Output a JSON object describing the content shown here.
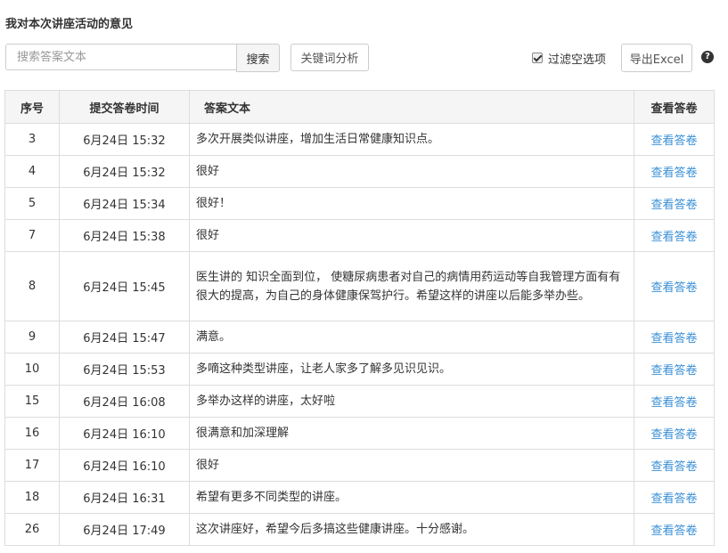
{
  "page": {
    "title": "我对本次讲座活动的意见"
  },
  "toolbar": {
    "search_placeholder": "搜索答案文本",
    "search_value": "",
    "search_label": "搜索",
    "keyword_label": "关键词分析",
    "filter_label": "过滤空选项",
    "filter_checked": true,
    "export_label": "导出Excel",
    "help_icon": "question-circle-icon",
    "help_glyph": "?"
  },
  "table": {
    "headers": [
      "序号",
      "提交答卷时间",
      "答案文本",
      "查看答卷"
    ],
    "rows": [
      {
        "no": "3",
        "time": "6月24日 15:32",
        "text": "多次开展类似讲座，增加生活日常健康知识点。",
        "view": "查看答卷"
      },
      {
        "no": "4",
        "time": "6月24日 15:32",
        "text": "很好",
        "view": "查看答卷"
      },
      {
        "no": "5",
        "time": "6月24日 15:34",
        "text": "很好！",
        "view": "查看答卷"
      },
      {
        "no": "7",
        "time": "6月24日 15:38",
        "text": "很好",
        "view": "查看答卷"
      },
      {
        "no": "8",
        "time": "6月24日 15:45",
        "text": "医生讲的 知识全面到位， 使糖尿病患者对自己的病情用药运动等自我管理方面有有很大的提高，为自己的身体健康保驾护行。希望这样的讲座以后能多举办些。",
        "view": "查看答卷"
      },
      {
        "no": "9",
        "time": "6月24日 15:47",
        "text": "满意。",
        "view": "查看答卷"
      },
      {
        "no": "10",
        "time": "6月24日 15:53",
        "text": "多嘀这种类型讲座，让老人家多了解多见识见识。",
        "view": "查看答卷"
      },
      {
        "no": "15",
        "time": "6月24日 16:08",
        "text": "多举办这样的讲座，太好啦",
        "view": "查看答卷"
      },
      {
        "no": "16",
        "time": "6月24日 16:10",
        "text": "很满意和加深理解",
        "view": "查看答卷"
      },
      {
        "no": "17",
        "time": "6月24日 16:10",
        "text": "很好",
        "view": "查看答卷"
      },
      {
        "no": "18",
        "time": "6月24日 16:31",
        "text": "希望有更多不同类型的讲座。",
        "view": "查看答卷"
      },
      {
        "no": "26",
        "time": "6月24日 17:49",
        "text": "这次讲座好，希望今后多搞这些健康讲座。十分感谢。",
        "view": "查看答卷"
      }
    ]
  },
  "colors": {
    "link": "#3a8fd6",
    "header_bg": "#f5f5f5",
    "border": "#dddddd"
  }
}
